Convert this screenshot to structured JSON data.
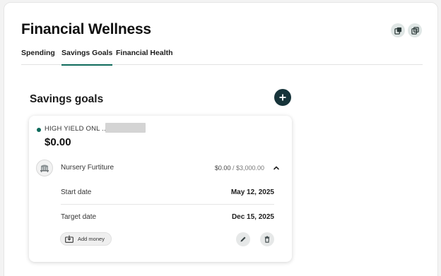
{
  "header": {
    "title": "Financial Wellness",
    "actions": [
      {
        "icon": "copy-icon"
      },
      {
        "icon": "duplicate-icon"
      }
    ]
  },
  "tabs": [
    {
      "label": "Spending",
      "active": false
    },
    {
      "label": "Savings Goals",
      "active": true
    },
    {
      "label": "Financial Health",
      "active": false
    }
  ],
  "savings": {
    "section_title": "Savings goals",
    "add_icon": "plus-icon",
    "account": {
      "name": "HIGH YIELD ONL ...",
      "balance": "$0.00",
      "status_color": "#0f6b5c"
    },
    "goal": {
      "icon": "crib-icon",
      "name": "Nursery Furtiture",
      "saved": "$0.00",
      "target": " / $3,000.00",
      "expanded": true,
      "start_date_label": "Start date",
      "start_date": "May 12, 2025",
      "target_date_label": "Target date",
      "target_date": "Dec 15, 2025",
      "add_money_label": "Add money"
    }
  },
  "colors": {
    "accent": "#0f6b5c",
    "dark_button": "#17343a"
  }
}
